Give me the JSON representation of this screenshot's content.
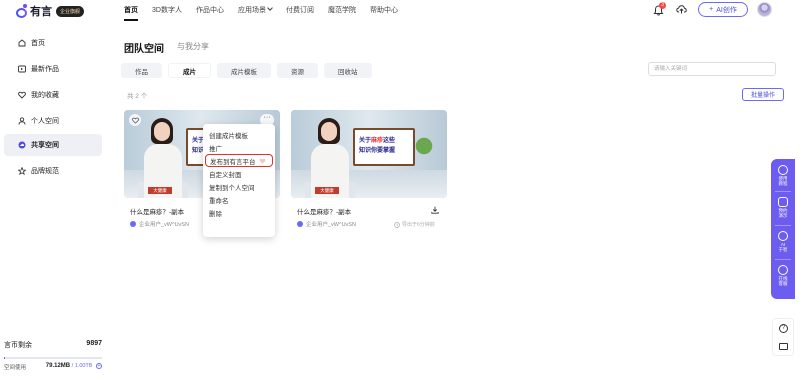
{
  "brand": {
    "name": "有言",
    "badge": "企业旗舰"
  },
  "nav": [
    {
      "label": "首页",
      "active": true
    },
    {
      "label": "3D数字人"
    },
    {
      "label": "作品中心"
    },
    {
      "label": "应用场景"
    },
    {
      "label": "付费订阅"
    },
    {
      "label": "魔范学院"
    },
    {
      "label": "帮助中心"
    }
  ],
  "header": {
    "notification_count": "3",
    "ai_create_label": "AI创作"
  },
  "sidebar": {
    "items": [
      {
        "label": "首页",
        "icon": "home-icon"
      },
      {
        "label": "最新作品",
        "icon": "play-icon"
      },
      {
        "label": "我的收藏",
        "icon": "heart-icon"
      },
      {
        "label": "个人空间",
        "icon": "user-icon"
      },
      {
        "label": "共享空间",
        "icon": "cloud-icon",
        "active": true
      },
      {
        "label": "品牌规范",
        "icon": "star-icon"
      }
    ],
    "coins_label": "言币剩余",
    "coins_value": "9897",
    "storage_label": "空间使用",
    "storage_used": "79.12MB",
    "storage_total": "/ 1.00TB",
    "storage_fraction": 0.0001
  },
  "main": {
    "title": "团队空间",
    "share_tab": "与我分享",
    "tabs": [
      "作品",
      "成片",
      "成片模板",
      "资源",
      "回收站"
    ],
    "active_tab": 1,
    "search_placeholder": "请输入关键词",
    "count_text": "共 2 个",
    "batch_label": "批量操作"
  },
  "cards": [
    {
      "name": "什么是麻疹？-副本",
      "user": "企业用户_vW^UvSN",
      "board_line1_prefix": "关于",
      "board_line1_hl": "麻疹",
      "board_line1_suffix": "这些",
      "board_line2": "知识你要掌握",
      "desk_label": "大健康",
      "export_text": ""
    },
    {
      "name": "什么是麻疹？-副本",
      "user": "企业用户_vW^UvSN",
      "board_line1_prefix": "关于",
      "board_line1_hl": "麻疹",
      "board_line1_suffix": "这些",
      "board_line2": "知识你要掌握",
      "desk_label": "大健康",
      "export_text": "导出于6分钟前"
    }
  ],
  "context_menu": [
    "创建成片模板",
    "推广",
    "发布到有言平台",
    "自定义封面",
    "复制到个人空间",
    "重命名",
    "删除"
  ],
  "float_bar": [
    {
      "label": "使用\n教程"
    },
    {
      "label": "预约\n演示"
    },
    {
      "label": "AI\n于智"
    },
    {
      "label": "在线\n客服"
    }
  ],
  "colors": {
    "accent": "#6a6af5",
    "highlight_border": "#e2312b",
    "float_bar": "#6c5cf0"
  }
}
